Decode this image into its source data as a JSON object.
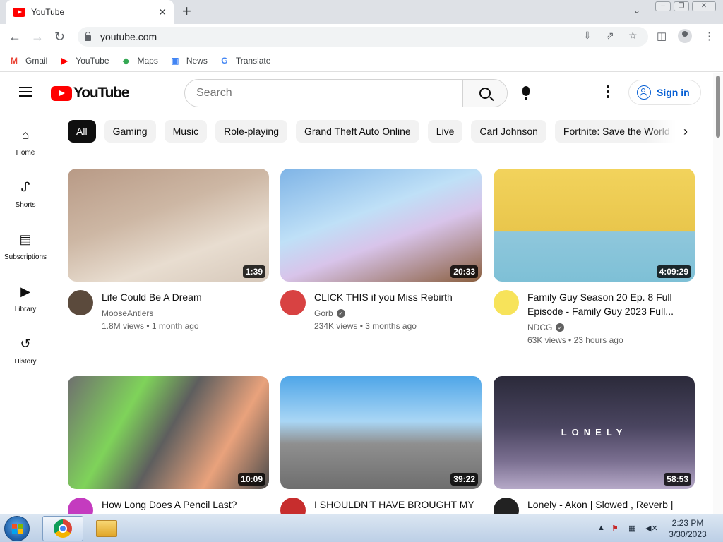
{
  "browser": {
    "tab_title": "YouTube",
    "close_symbol": "✕",
    "new_tab_symbol": "+",
    "url": "youtube.com",
    "bookmarks": [
      {
        "label": "Gmail",
        "icon": "gmail-icon",
        "glyph": "M",
        "color": "#ea4335"
      },
      {
        "label": "YouTube",
        "icon": "youtube-icon",
        "glyph": "▶",
        "color": "#ff0000"
      },
      {
        "label": "Maps",
        "icon": "maps-icon",
        "glyph": "◆",
        "color": "#34a853"
      },
      {
        "label": "News",
        "icon": "news-icon",
        "glyph": "▣",
        "color": "#4285f4"
      },
      {
        "label": "Translate",
        "icon": "translate-icon",
        "glyph": "G",
        "color": "#4285f4"
      }
    ]
  },
  "youtube": {
    "logo_text": "YouTube",
    "search_placeholder": "Search",
    "sign_in_label": "Sign in",
    "brand_color": "#ff0000",
    "link_color": "#065fd4",
    "sidebar": [
      {
        "label": "Home",
        "icon": "home-icon",
        "glyph": "⌂"
      },
      {
        "label": "Shorts",
        "icon": "shorts-icon",
        "glyph": "ᔑ"
      },
      {
        "label": "Subscriptions",
        "icon": "subscriptions-icon",
        "glyph": "▤"
      },
      {
        "label": "Library",
        "icon": "library-icon",
        "glyph": "▶"
      },
      {
        "label": "History",
        "icon": "history-icon",
        "glyph": "↺"
      }
    ],
    "chips": [
      "All",
      "Gaming",
      "Music",
      "Role-playing",
      "Grand Theft Auto Online",
      "Live",
      "Carl Johnson",
      "Fortnite: Save the World"
    ],
    "active_chip": "All",
    "videos": [
      {
        "title": "Life Could Be A Dream",
        "channel": "MooseAntlers",
        "verified": false,
        "stats": "1.8M views • 1 month ago",
        "duration": "1:39"
      },
      {
        "title": "CLICK THIS if you Miss Rebirth",
        "channel": "Gorb",
        "verified": true,
        "stats": "234K views • 3 months ago",
        "duration": "20:33"
      },
      {
        "title": "Family Guy Season 20 Ep. 8 Full Episode - Family Guy 2023 Full...",
        "channel": "NDCG",
        "verified": true,
        "stats": "63K views • 23 hours ago",
        "duration": "4:09:29"
      },
      {
        "title": "How Long Does A Pencil Last?",
        "channel": "",
        "verified": false,
        "stats": "",
        "duration": "10:09"
      },
      {
        "title": "I SHOULDN'T HAVE BROUGHT MY",
        "channel": "",
        "verified": false,
        "stats": "",
        "duration": "39:22"
      },
      {
        "title": "Lonely - Akon | Slowed , Reverb |",
        "channel": "",
        "verified": false,
        "stats": "",
        "duration": "58:53",
        "thumb_text": "LONELY"
      }
    ]
  },
  "taskbar": {
    "time": "2:23 PM",
    "date": "3/30/2023"
  }
}
